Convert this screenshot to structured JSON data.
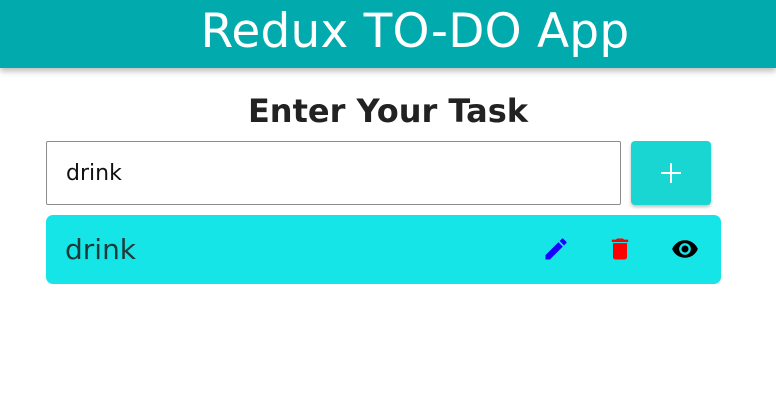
{
  "header": {
    "title": "Redux TO-DO App"
  },
  "form": {
    "heading": "Enter Your Task",
    "input_value": "drink",
    "add_button_icon": "plus-icon"
  },
  "todos": [
    {
      "text": "drink",
      "actions": [
        "edit-icon",
        "delete-icon",
        "view-icon"
      ]
    }
  ],
  "colors": {
    "header_bg": "#00aaad",
    "add_button_bg": "#19d6d3",
    "todo_bg": "#15e5e6",
    "edit_icon": "#1a00ff",
    "delete_icon": "#ff0000",
    "view_icon": "#000000"
  }
}
